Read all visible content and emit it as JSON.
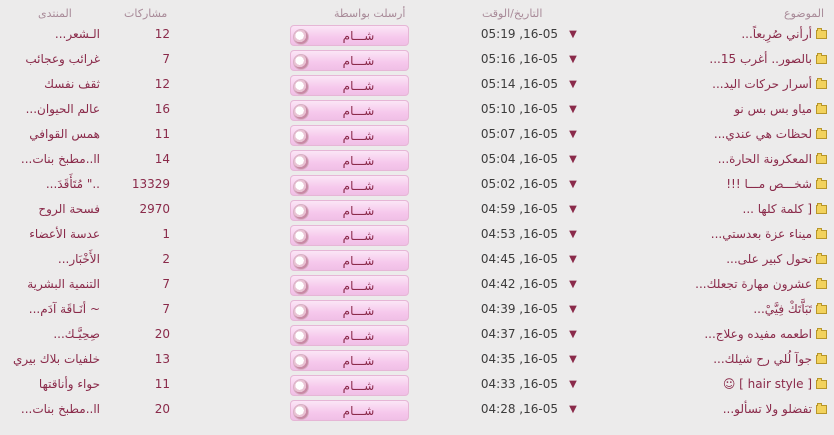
{
  "headers": {
    "topic": "الموضوع",
    "datetime": "التاريخ/الوقت",
    "sentby": "أرسلت بواسطة",
    "posts": "مشاركات",
    "forum": "المنتدى"
  },
  "rows": [
    {
      "topic": "أرأني صُرِبعاً...",
      "date": "05:19 ,16-05",
      "user": "شـــام",
      "posts": "12",
      "forum": "الـشعر..."
    },
    {
      "topic": "بالصور.. أغرب 15...",
      "date": "05:16 ,16-05",
      "user": "شـــام",
      "posts": "7",
      "forum": "غرائب وعجائب"
    },
    {
      "topic": "أسرار حركات اليد...",
      "date": "05:14 ,16-05",
      "user": "شـــام",
      "posts": "12",
      "forum": "ثقف نفسك"
    },
    {
      "topic": "مياو بس بس نو",
      "date": "05:10 ,16-05",
      "user": "شـــام",
      "posts": "16",
      "forum": "عالم الحيوان..."
    },
    {
      "topic": "لحظات هي عندي...",
      "date": "05:07 ,16-05",
      "user": "شـــام",
      "posts": "11",
      "forum": "همس القوافي"
    },
    {
      "topic": "المعكرونة الحارة...",
      "date": "05:04 ,16-05",
      "user": "شـــام",
      "posts": "14",
      "forum": "اا..مطبخ بنات..."
    },
    {
      "topic": "شخـــص مـــا !!!",
      "date": "05:02 ,16-05",
      "user": "شـــام",
      "posts": "13329",
      "forum": "..\" مُتَأَقَدَ..."
    },
    {
      "topic": "[ كلمة كلها ...",
      "date": "04:59 ,16-05",
      "user": "شـــام",
      "posts": "2970",
      "forum": "فسحة الروح"
    },
    {
      "topic": "ميناء عزة بعدستي...",
      "date": "04:53 ,16-05",
      "user": "شـــام",
      "posts": "1",
      "forum": "عدسة الأعضاء"
    },
    {
      "topic": "تحول كبير على...",
      "date": "04:45 ,16-05",
      "user": "شـــام",
      "posts": "2",
      "forum": "الأَخْبَار..."
    },
    {
      "topic": "عشرون مهارة تجعلك...",
      "date": "04:42 ,16-05",
      "user": "شـــام",
      "posts": "7",
      "forum": "التنمية البشرية"
    },
    {
      "topic": "تَبَاَّتَكْ فِيَّيْ...",
      "date": "04:39 ,16-05",
      "user": "شـــام",
      "posts": "7",
      "forum": "~ أنَـاقَة آدَم..."
    },
    {
      "topic": "اطعمه مفيده وعلاج...",
      "date": "04:37 ,16-05",
      "user": "شـــام",
      "posts": "20",
      "forum": "صِحِيَّـك..."
    },
    {
      "topic": "جوآ لُلي رح شيلك...",
      "date": "04:35 ,16-05",
      "user": "شـــام",
      "posts": "13",
      "forum": "خلفيات بلاك بيري"
    },
    {
      "topic": "[ hair style ] ☺",
      "date": "04:33 ,16-05",
      "user": "شـــام",
      "posts": "11",
      "forum": "حواء وأناقتها"
    },
    {
      "topic": "تفضلو ولا تسألو...",
      "date": "04:28 ,16-05",
      "user": "شـــام",
      "posts": "20",
      "forum": "اا..مطبخ بنات..."
    }
  ]
}
